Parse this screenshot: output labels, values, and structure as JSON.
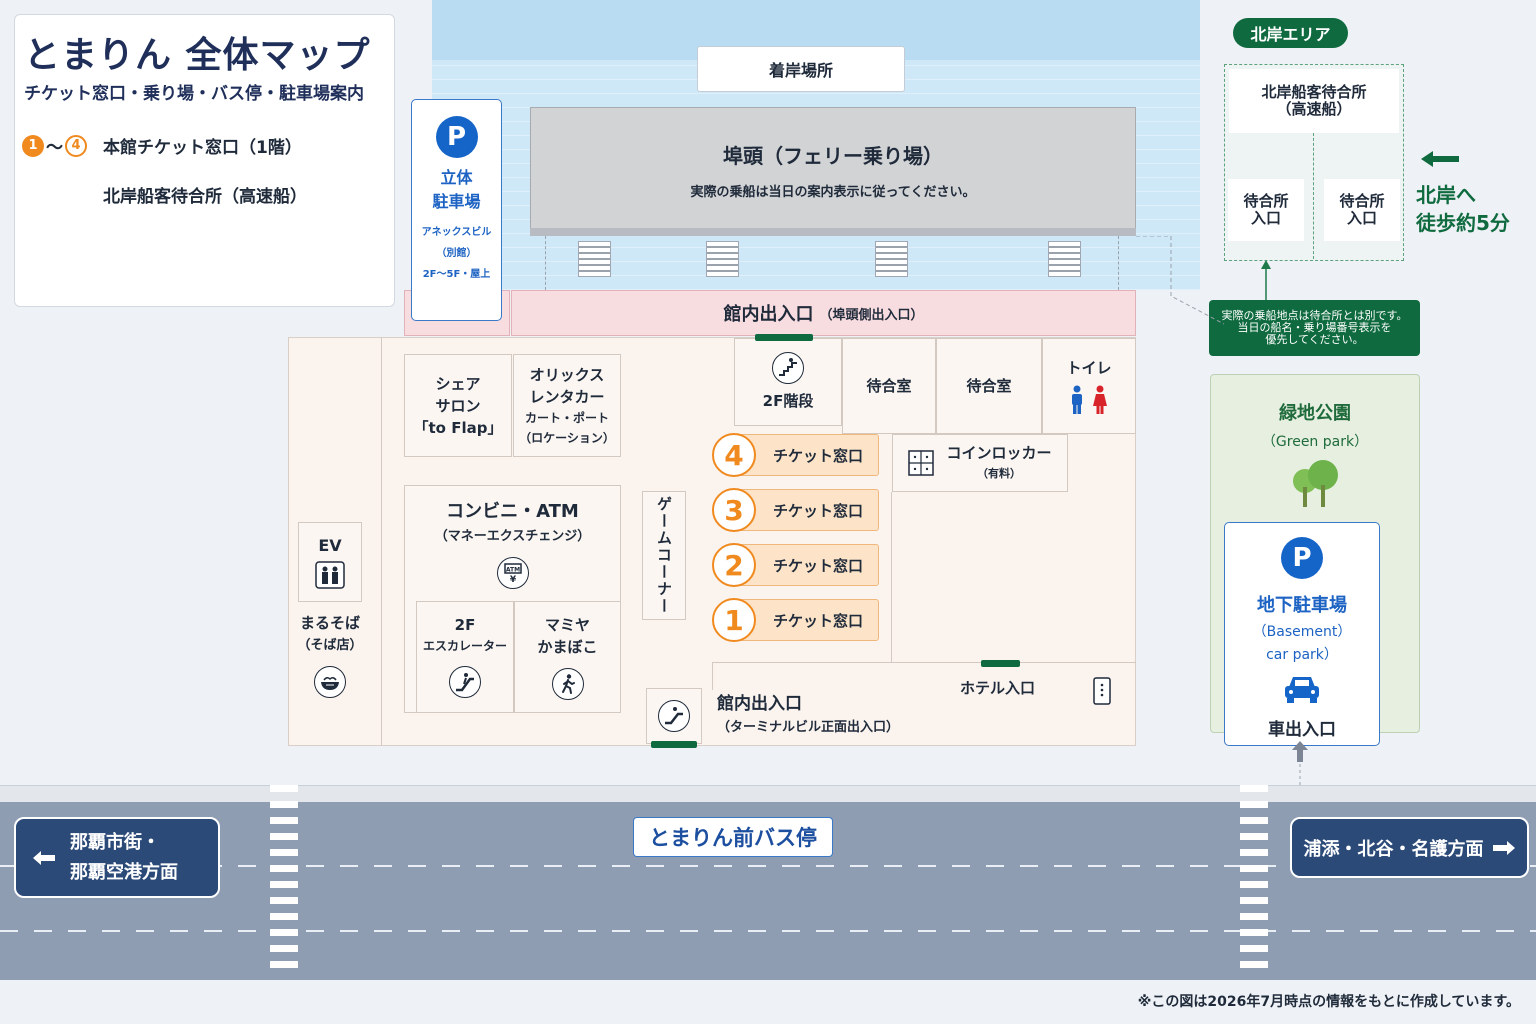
{
  "legend": {
    "title": "とまりん 全体マップ",
    "subtitle": "チケット窓口・乗り場・バス停・駐車場案内",
    "range_start": "1",
    "range_sep": "〜",
    "range_end": "4",
    "range_label": "本館チケット窓口（1階）",
    "north_label": "北岸船客待合所（高速船）"
  },
  "landing": "着岸場所",
  "pier": {
    "title": "埠頭（フェリー乗り場）",
    "note": "実際の乗船は当日の案内表示に従ってください。"
  },
  "parking_tower": {
    "badge": "P",
    "name1": "立体",
    "name2": "駐車場",
    "sub1": "アネックスビル",
    "sub2": "（別館）",
    "sub3": "2F〜5F・屋上"
  },
  "pier_entrance": {
    "title": "館内出入口",
    "sub": "（埠頭側出入口）"
  },
  "rooms": {
    "share_salon": [
      "シェア",
      "サロン",
      "「to Flap」"
    ],
    "orix": [
      "オリックス",
      "レンタカー",
      "カート・ポート",
      "（ロケーション）"
    ],
    "stairs": "2F階段",
    "waiting1": "待合室",
    "waiting2": "待合室",
    "toilet": "トイレ",
    "coin_locker": "コインロッカー",
    "coin_locker_sub": "（有料）",
    "convenience": "コンビニ・ATM",
    "convenience_sub": "（マネーエクスチェンジ）",
    "game_corner": "ゲームコーナー",
    "escalator": [
      "2F",
      "エスカレーター"
    ],
    "mamiya": [
      "マミヤ",
      "かまぼこ"
    ],
    "ev": "EV",
    "marusoba": "まるそば",
    "marusoba_sub": "（そば店）",
    "front_entrance": "館内出入口",
    "front_entrance_sub": "（ターミナルビル正面出入口）",
    "hotel_entrance": "ホテル入口"
  },
  "counters": [
    {
      "number": "4",
      "label": "チケット窓口"
    },
    {
      "number": "3",
      "label": "チケット窓口"
    },
    {
      "number": "2",
      "label": "チケット窓口"
    },
    {
      "number": "1",
      "label": "チケット窓口"
    }
  ],
  "north": {
    "badge": "北岸エリア",
    "head1": "北岸船客待合所",
    "head2": "（高速船）",
    "ent1": [
      "待合所",
      "入口"
    ],
    "ent2": [
      "待合所",
      "入口"
    ],
    "note1": "実際の乗船地点は待合所とは別です。",
    "note2": "当日の船名・乗り場番号表示を",
    "note3": "優先してください。",
    "walk1": "北岸へ",
    "walk2": "徒歩約5分"
  },
  "green_park": {
    "title": "緑地公園",
    "sub": "（Green park）",
    "parking_badge": "P",
    "parking_name": "地下駐車場",
    "parking_sub1": "（Basement）",
    "parking_sub2": "car park）",
    "car_exit": "車出入口"
  },
  "road": {
    "left_sign1": "那覇市街・",
    "left_sign2": "那覇空港方面",
    "bus_stop": "とまりん前バス停",
    "right_sign": "浦添・北谷・名護方面"
  },
  "footnote": "※この図は2026年7月時点の情報をもとに作成しています。",
  "colors": {
    "ticket_orange": "#f08a1f",
    "parking_blue": "#1565c9",
    "north_green": "#0f6b3f"
  }
}
